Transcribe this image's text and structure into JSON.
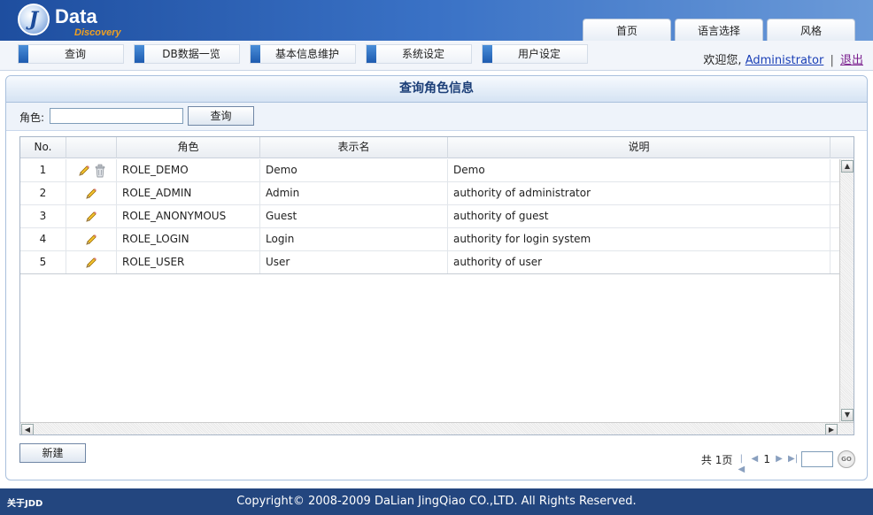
{
  "brand": {
    "logo_letter": "J",
    "name": "Data",
    "sub": "Discovery"
  },
  "top_tabs": [
    {
      "label": "首页"
    },
    {
      "label": "语言选择"
    },
    {
      "label": "风格"
    }
  ],
  "menu": [
    {
      "label": "查询"
    },
    {
      "label": "DB数据一览"
    },
    {
      "label": "基本信息维护"
    },
    {
      "label": "系统设定"
    },
    {
      "label": "用户设定"
    }
  ],
  "welcome": {
    "prefix": "欢迎您,",
    "user": "Administrator",
    "separator": "|",
    "logout": "退出"
  },
  "panel": {
    "title": "查询角色信息"
  },
  "search": {
    "label": "角色:",
    "value": "",
    "button": "查询"
  },
  "grid": {
    "columns": [
      "No.",
      "",
      "角色",
      "表示名",
      "说明"
    ],
    "rows": [
      {
        "no": "1",
        "role": "ROLE_DEMO",
        "display": "Demo",
        "desc": "Demo",
        "deletable": true
      },
      {
        "no": "2",
        "role": "ROLE_ADMIN",
        "display": "Admin",
        "desc": "authority of administrator",
        "deletable": false
      },
      {
        "no": "3",
        "role": "ROLE_ANONYMOUS",
        "display": "Guest",
        "desc": "authority of guest",
        "deletable": false
      },
      {
        "no": "4",
        "role": "ROLE_LOGIN",
        "display": "Login",
        "desc": "authority for login system",
        "deletable": false
      },
      {
        "no": "5",
        "role": "ROLE_USER",
        "display": "User",
        "desc": "authority of user",
        "deletable": false
      }
    ]
  },
  "new_button": "新建",
  "pager": {
    "total_label": "共 1页",
    "current": "1",
    "go_label": "GO"
  },
  "footer": {
    "about": "关于JDD",
    "copyright": "Copyright© 2008-2009 DaLian JingQiao CO.,LTD. All Rights Reserved."
  }
}
